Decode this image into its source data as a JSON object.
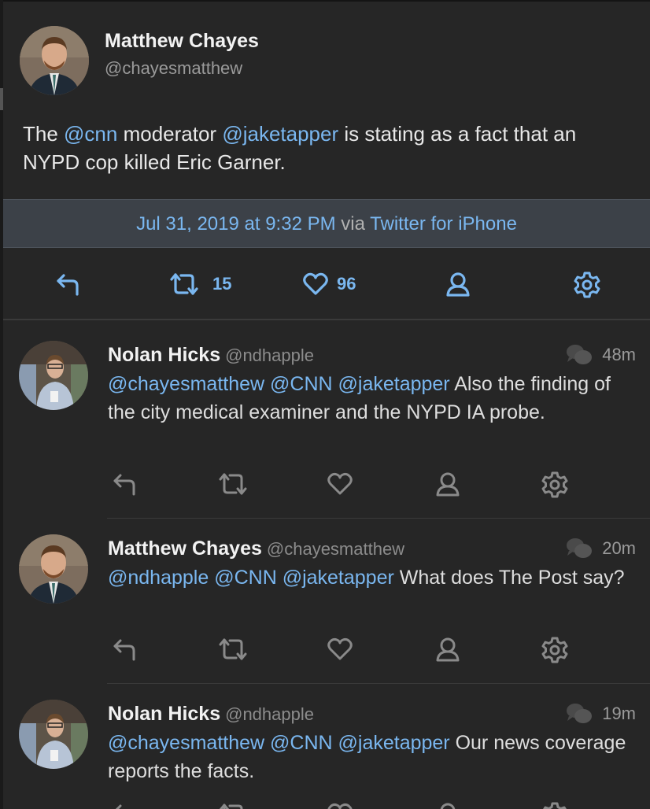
{
  "main_tweet": {
    "name": "Matthew Chayes",
    "handle": "@chayesmatthew",
    "text_prefix": "The ",
    "mention1": "@cnn",
    "text_mid1": " moderator ",
    "mention2": "@jaketapper",
    "text_mid2": " is stating as a fact that an NYPD cop killed Eric Garner.",
    "date": "Jul 31, 2019 at 9:32 PM",
    "via": "via",
    "client": "Twitter for iPhone",
    "retweets": "15",
    "likes": "96",
    "avatar_icon": "person-avatar"
  },
  "replies": [
    {
      "name": "Nolan Hicks",
      "handle": "@ndhapple",
      "age": "48m",
      "mentions": "@chayesmatthew @CNN @jaketapper",
      "text": " Also the finding of the city medical examiner and the NYPD IA probe."
    },
    {
      "name": "Matthew Chayes",
      "handle": "@chayesmatthew",
      "age": "20m",
      "mentions": "@ndhapple @CNN @jaketapper",
      "text": " What does The Post say?"
    },
    {
      "name": "Nolan Hicks",
      "handle": "@ndhapple",
      "age": "19m",
      "mentions": "@chayesmatthew @CNN @jaketapper",
      "text": " Our news coverage reports the facts."
    }
  ],
  "colors": {
    "background": "#262626",
    "link": "#7ab7f0",
    "info_bar": "#3c4148",
    "muted_icon": "#8a8a8a"
  },
  "icons": [
    "reply-icon",
    "retweet-icon",
    "like-icon",
    "profile-icon",
    "settings-gear-icon",
    "conversation-icon"
  ]
}
